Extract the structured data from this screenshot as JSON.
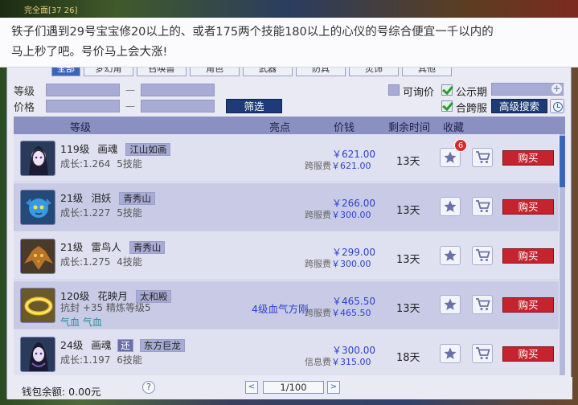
{
  "window": {
    "top_label": "完全面[37 26]"
  },
  "announcement": {
    "line1": "铁子们遇到29号宝宝修20以上的、或者175两个技能180以上的心仪的号综合便宜一千以内的",
    "line2": "马上秒了吧。号价马上会大涨!"
  },
  "tabs": [
    "全部",
    "梦幻角",
    "召唤兽",
    "角色",
    "武器",
    "防具",
    "灵饰",
    "其他"
  ],
  "filters": {
    "level_label": "等级",
    "price_label": "价格",
    "range_sep": "—",
    "filter_button": "筛选",
    "negotiable_label": "可询价",
    "negotiable_checked": false,
    "public_label": "公示期",
    "public_checked": true,
    "cross_server_label": "合跨服",
    "cross_server_checked": true,
    "advanced_search": "高级搜索"
  },
  "columns": {
    "level": "等级",
    "highlight": "亮点",
    "price": "价钱",
    "remaining": "剩余时间",
    "favorite": "收藏"
  },
  "rows": [
    {
      "level": "119级",
      "name": "画魂",
      "server": "江山如画",
      "growth": "成长:1.264",
      "skills": "5技能",
      "extra": "",
      "highlight": "",
      "price": "￥621.00",
      "fee_label": "跨服费",
      "fee": "￥621.00",
      "days": "13天",
      "fav_count": "6",
      "buy": "购买"
    },
    {
      "level": "21级",
      "name": "泪妖",
      "server": "青秀山",
      "growth": "成长:1.227",
      "skills": "5技能",
      "extra": "",
      "highlight": "",
      "price": "￥266.00",
      "fee_label": "跨服费",
      "fee": "￥300.00",
      "days": "13天",
      "fav_count": "",
      "buy": "购买"
    },
    {
      "level": "21级",
      "name": "雷鸟人",
      "server": "青秀山",
      "growth": "成长:1.275",
      "skills": "4技能",
      "extra": "",
      "highlight": "",
      "price": "￥299.00",
      "fee_label": "跨服费",
      "fee": "￥300.00",
      "days": "13天",
      "fav_count": "",
      "buy": "购买"
    },
    {
      "level": "120级",
      "name": "花映月",
      "server": "太和殿",
      "growth": "抗封 +35 精炼等级5",
      "skills": "",
      "extra": "气血 气血",
      "highlight": "4级血气方刚",
      "price": "￥465.50",
      "fee_label": "跨服费",
      "fee": "￥465.50",
      "days": "13天",
      "fav_count": "",
      "buy": "购买"
    },
    {
      "level": "24级",
      "name": "画魂",
      "tag2": "还",
      "server": "东方巨龙",
      "growth": "成长:1.197",
      "skills": "6技能",
      "extra": "",
      "highlight": "",
      "price": "￥300.00",
      "fee_label": "信息费",
      "fee": "￥315.00",
      "days": "18天",
      "fav_count": "",
      "buy": "购买"
    }
  ],
  "footer": {
    "wallet": "钱包余额: 0.00元",
    "help": "?",
    "prev": "<",
    "page": "1/100",
    "next": ">"
  },
  "colors": {
    "accent_blue": "#3a66b8",
    "buy_red": "#c5242f",
    "price_blue": "#2b3fd0",
    "header_purple": "#8b90c3"
  }
}
